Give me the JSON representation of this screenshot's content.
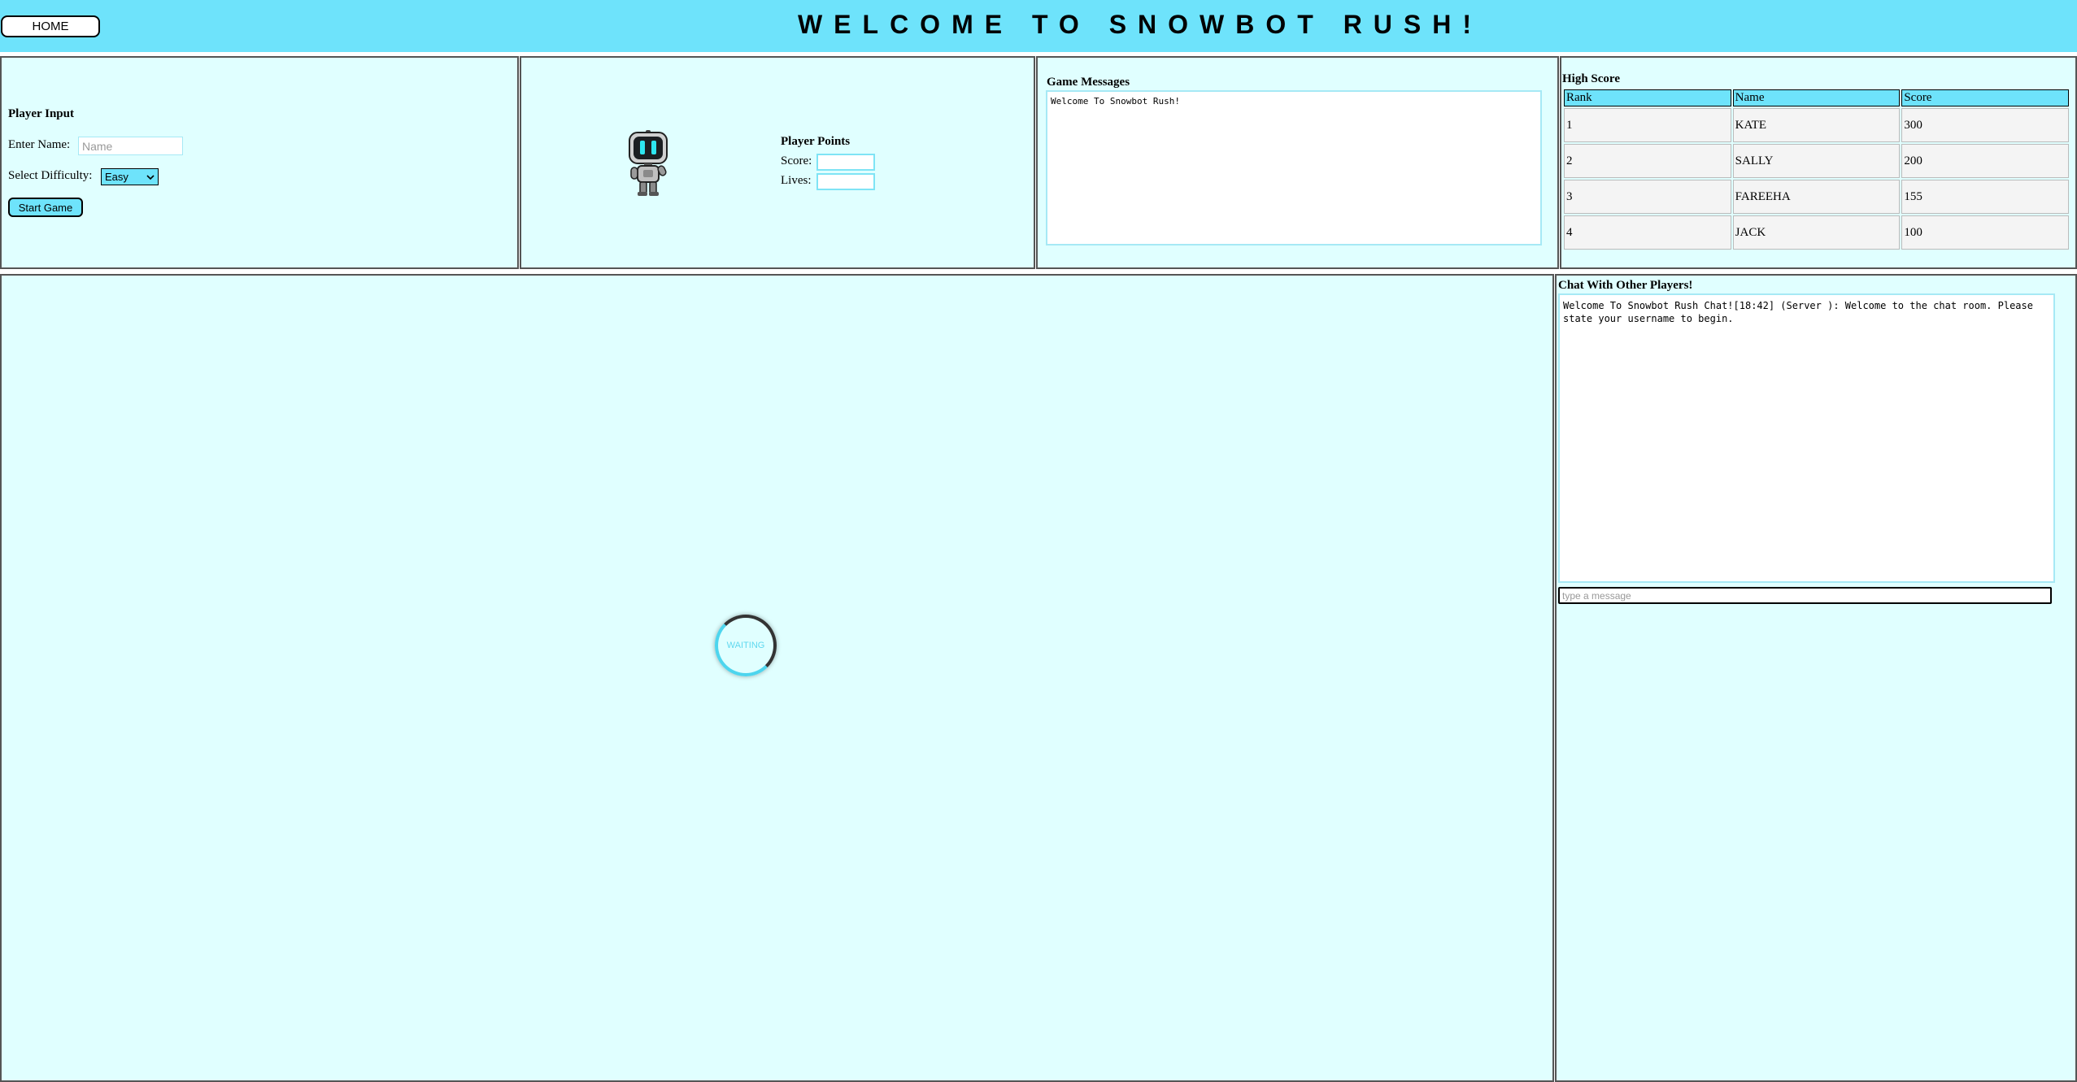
{
  "header": {
    "home_label": "HOME",
    "title": "WELCOME TO SNOWBOT RUSH!",
    "background": "#6ee3fb"
  },
  "player_input": {
    "heading": "Player Input",
    "name_label": "Enter Name:",
    "name_placeholder": "Name",
    "difficulty_label": "Select Difficulty:",
    "difficulty_selected": "Easy",
    "start_label": "Start Game"
  },
  "player_points": {
    "heading": "Player Points",
    "score_label": "Score:",
    "lives_label": "Lives:",
    "score_value": "",
    "lives_value": ""
  },
  "game_messages": {
    "heading": "Game Messages",
    "text": "Welcome To Snowbot Rush!"
  },
  "high_score": {
    "heading": "High Score",
    "columns": [
      "Rank",
      "Name",
      "Score"
    ],
    "rows": [
      [
        "1",
        "KATE",
        "300"
      ],
      [
        "2",
        "SALLY",
        "200"
      ],
      [
        "3",
        "FAREEHA",
        "155"
      ],
      [
        "4",
        "JACK",
        "100"
      ]
    ]
  },
  "game_area": {
    "status": "WAITING"
  },
  "chat": {
    "heading": "Chat With Other Players!",
    "log": "Welcome To Snowbot Rush Chat![18:42] (Server ): Welcome to the chat room. Please state your username to begin.",
    "input_placeholder": "type a message"
  },
  "colors": {
    "accent": "#6ee3fb",
    "panel_bg": "#e0ffff",
    "spinner_accent": "#4dd5ee"
  }
}
